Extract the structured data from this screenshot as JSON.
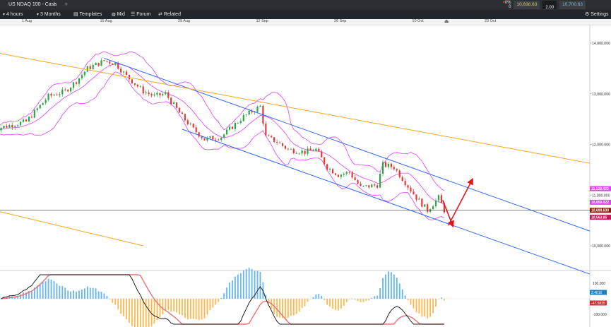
{
  "window": {
    "title": "US NDAQ 100 - Cash",
    "add_tab": "+"
  },
  "quote": {
    "change": "0%",
    "change_points": "0",
    "sell": "10,698.63",
    "spread": "2.00",
    "buy": "10,700.63"
  },
  "toolbar": {
    "interval": "4 hours",
    "range": "3 Months",
    "templates": "Templates",
    "price_mode": "Mid",
    "forum": "Forum",
    "related": "Related",
    "settings": "Settings"
  },
  "chart_data": [
    {
      "type": "candlestick",
      "title": "US NDAQ 100 - Cash",
      "x_tick_labels": [
        "1 Aug",
        "15 Aug",
        "29 Aug",
        "12 Sep",
        "26 Sep",
        "10 Oct",
        "23 Oct"
      ],
      "y_tick_labels": [
        "14,000.000",
        "13,000.000",
        "12,000.000",
        "11,000.000",
        "10,000.000"
      ],
      "ylim": [
        9950,
        14250
      ],
      "price_track": [
        {
          "date": "1 Aug",
          "price": 12450
        },
        {
          "date": "3 Aug",
          "price": 12700
        },
        {
          "date": "5 Aug",
          "price": 12950
        },
        {
          "date": "8 Aug",
          "price": 13050
        },
        {
          "date": "10 Aug",
          "price": 13250
        },
        {
          "date": "12 Aug",
          "price": 13500
        },
        {
          "date": "15 Aug",
          "price": 13650
        },
        {
          "date": "17 Aug",
          "price": 13600
        },
        {
          "date": "19 Aug",
          "price": 13350
        },
        {
          "date": "22 Aug",
          "price": 13050
        },
        {
          "date": "24 Aug",
          "price": 12950
        },
        {
          "date": "26 Aug",
          "price": 13000
        },
        {
          "date": "29 Aug",
          "price": 12550
        },
        {
          "date": "31 Aug",
          "price": 12300
        },
        {
          "date": "2 Sep",
          "price": 12100
        },
        {
          "date": "5 Sep",
          "price": 12150
        },
        {
          "date": "7 Sep",
          "price": 12350
        },
        {
          "date": "9 Sep",
          "price": 12550
        },
        {
          "date": "12 Sep",
          "price": 12750
        },
        {
          "date": "13 Sep",
          "price": 12150
        },
        {
          "date": "15 Sep",
          "price": 12050
        },
        {
          "date": "17 Sep",
          "price": 11900
        },
        {
          "date": "20 Sep",
          "price": 11850
        },
        {
          "date": "22 Sep",
          "price": 11900
        },
        {
          "date": "24 Sep",
          "price": 11550
        },
        {
          "date": "26 Sep",
          "price": 11400
        },
        {
          "date": "28 Sep",
          "price": 11450
        },
        {
          "date": "30 Sep",
          "price": 11150
        },
        {
          "date": "3 Oct",
          "price": 11200
        },
        {
          "date": "4 Oct",
          "price": 11600
        },
        {
          "date": "6 Oct",
          "price": 11550
        },
        {
          "date": "8 Oct",
          "price": 11250
        },
        {
          "date": "10 Oct",
          "price": 10950
        },
        {
          "date": "12 Oct",
          "price": 10700
        },
        {
          "date": "14 Oct",
          "price": 10950
        },
        {
          "date": "15 Oct",
          "price": 10698
        }
      ],
      "price_labels": [
        {
          "value": 11128.433,
          "label": "11,128.433",
          "color": "#e040fb"
        },
        {
          "value": 10859.022,
          "label": "10,859.022",
          "color": "#e040fb"
        },
        {
          "value": 10699.63,
          "label": "10,699.630",
          "color": "#8b1d0f"
        },
        {
          "value": 10563.95,
          "label": "10,563.95",
          "color": "#c2185b"
        }
      ],
      "current_price": 10699.63,
      "current_price_label": "10,699.630",
      "trend_lines": [
        {
          "color": "#3366ff",
          "from": {
            "date": "15 Aug",
            "price": 13700
          },
          "to": {
            "date": "23 Oct",
            "price": 11000
          }
        },
        {
          "color": "#3366ff",
          "from": {
            "date": "29 Aug",
            "price": 12300
          },
          "to": {
            "date": "23 Oct",
            "price": 10150
          }
        },
        {
          "color": "#f5a623",
          "from": {
            "date": "1 Aug",
            "price": 13700
          },
          "to": {
            "date": "23 Oct",
            "price": 12000
          }
        },
        {
          "color": "#f5a623",
          "from": {
            "date": "1 Aug",
            "price": 10550
          },
          "to": {
            "date": "22 Aug",
            "price": 10000
          }
        }
      ],
      "forecast_arrows": [
        {
          "color": "#e8141c",
          "from": {
            "date": "15 Oct",
            "price": 10900
          },
          "to": {
            "date": "16 Oct",
            "price": 10400
          }
        },
        {
          "color": "#e8141c",
          "from": {
            "date": "16 Oct",
            "price": 10400
          },
          "to": {
            "date": "19 Oct",
            "price": 11300
          }
        }
      ],
      "indicators": [
        "Bollinger Bands"
      ]
    },
    {
      "type": "macd",
      "y_tick_labels": [
        "100.000",
        "-100.000"
      ],
      "value_labels": [
        {
          "value": 2.4616,
          "label": "2.4616",
          "color": "#1f7fc4"
        },
        {
          "value": -47.5835,
          "label": "-47.5835",
          "color": "#d32f2f"
        }
      ]
    }
  ],
  "colors": {
    "up": "#27a844",
    "down": "#e53935",
    "bollinger": "#e040fb",
    "channel": "#3366ff",
    "trend": "#f5a623",
    "arrow": "#e8141c"
  }
}
